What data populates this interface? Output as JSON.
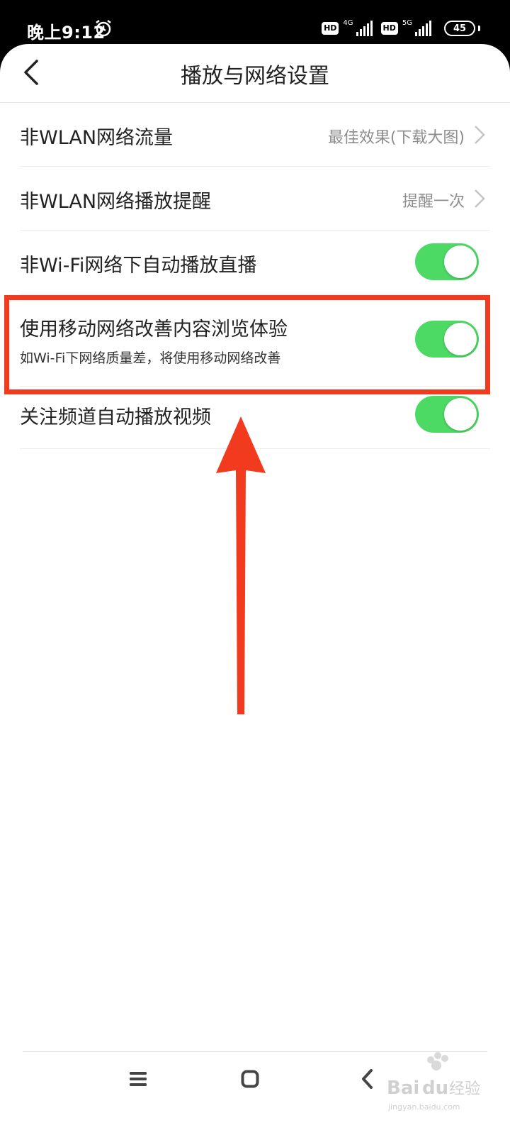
{
  "status_bar": {
    "time": "晚上9:12",
    "hd_badge_1": "HD",
    "network_1": "4G",
    "hd_badge_2": "HD",
    "network_2": "5G",
    "battery_level": "45"
  },
  "header": {
    "title": "播放与网络设置"
  },
  "settings": [
    {
      "title": "非WLAN网络流量",
      "value": "最佳效果(下载大图)",
      "control": "chevron"
    },
    {
      "title": "非WLAN网络播放提醒",
      "value": "提醒一次",
      "control": "chevron"
    },
    {
      "title": "非Wi-Fi网络下自动播放直播",
      "control": "toggle",
      "on": true
    },
    {
      "title": "使用移动网络改善内容浏览体验",
      "subtitle": "如Wi-Fi下网络质量差，将使用移动网络改善",
      "control": "toggle",
      "on": true,
      "highlighted": true
    },
    {
      "title": "关注频道自动播放视频",
      "control": "toggle",
      "on": true
    }
  ],
  "colors": {
    "toggle_on": "#4cd964",
    "annotation_red": "#f23a1e"
  },
  "icons": [
    "alarm-icon",
    "back-icon",
    "chevron-right-icon",
    "nav-menu-icon",
    "nav-home-icon",
    "nav-back-icon"
  ],
  "watermark": "Baidu经验 jingyan.baidu.com"
}
